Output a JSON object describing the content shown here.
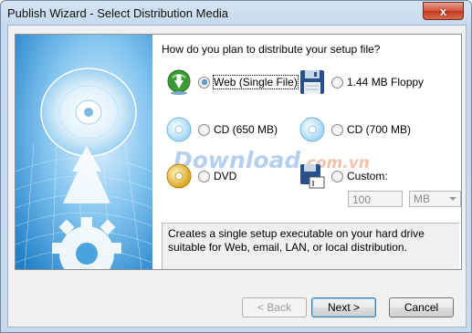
{
  "window": {
    "title": "Publish Wizard - Select Distribution Media",
    "close_glyph": "x"
  },
  "question": "How do you plan to distribute your setup file?",
  "options": [
    {
      "label": "Web (Single File)",
      "icon": "web-download-icon",
      "selected": true
    },
    {
      "label": "1.44 MB Floppy",
      "icon": "floppy-disk-icon",
      "selected": false
    },
    {
      "label": "CD (650 MB)",
      "icon": "cd-icon",
      "selected": false
    },
    {
      "label": "CD (700 MB)",
      "icon": "cd-icon",
      "selected": false
    },
    {
      "label": "DVD",
      "icon": "dvd-icon",
      "selected": false
    },
    {
      "label": "Custom:",
      "icon": "custom-floppy-icon",
      "selected": false
    }
  ],
  "custom_size": {
    "value": "100",
    "unit": "MB"
  },
  "description": "Creates a single setup executable on your hard drive suitable for Web, email, LAN, or local distribution.",
  "watermark": {
    "main": "Download",
    "suffix": ".com.vn"
  },
  "buttons": {
    "back": "< Back",
    "next": "Next >",
    "cancel": "Cancel"
  },
  "colors": {
    "accent": "#1d5fae",
    "panel_border": "#8e8f8f",
    "close": "#c4391f"
  }
}
